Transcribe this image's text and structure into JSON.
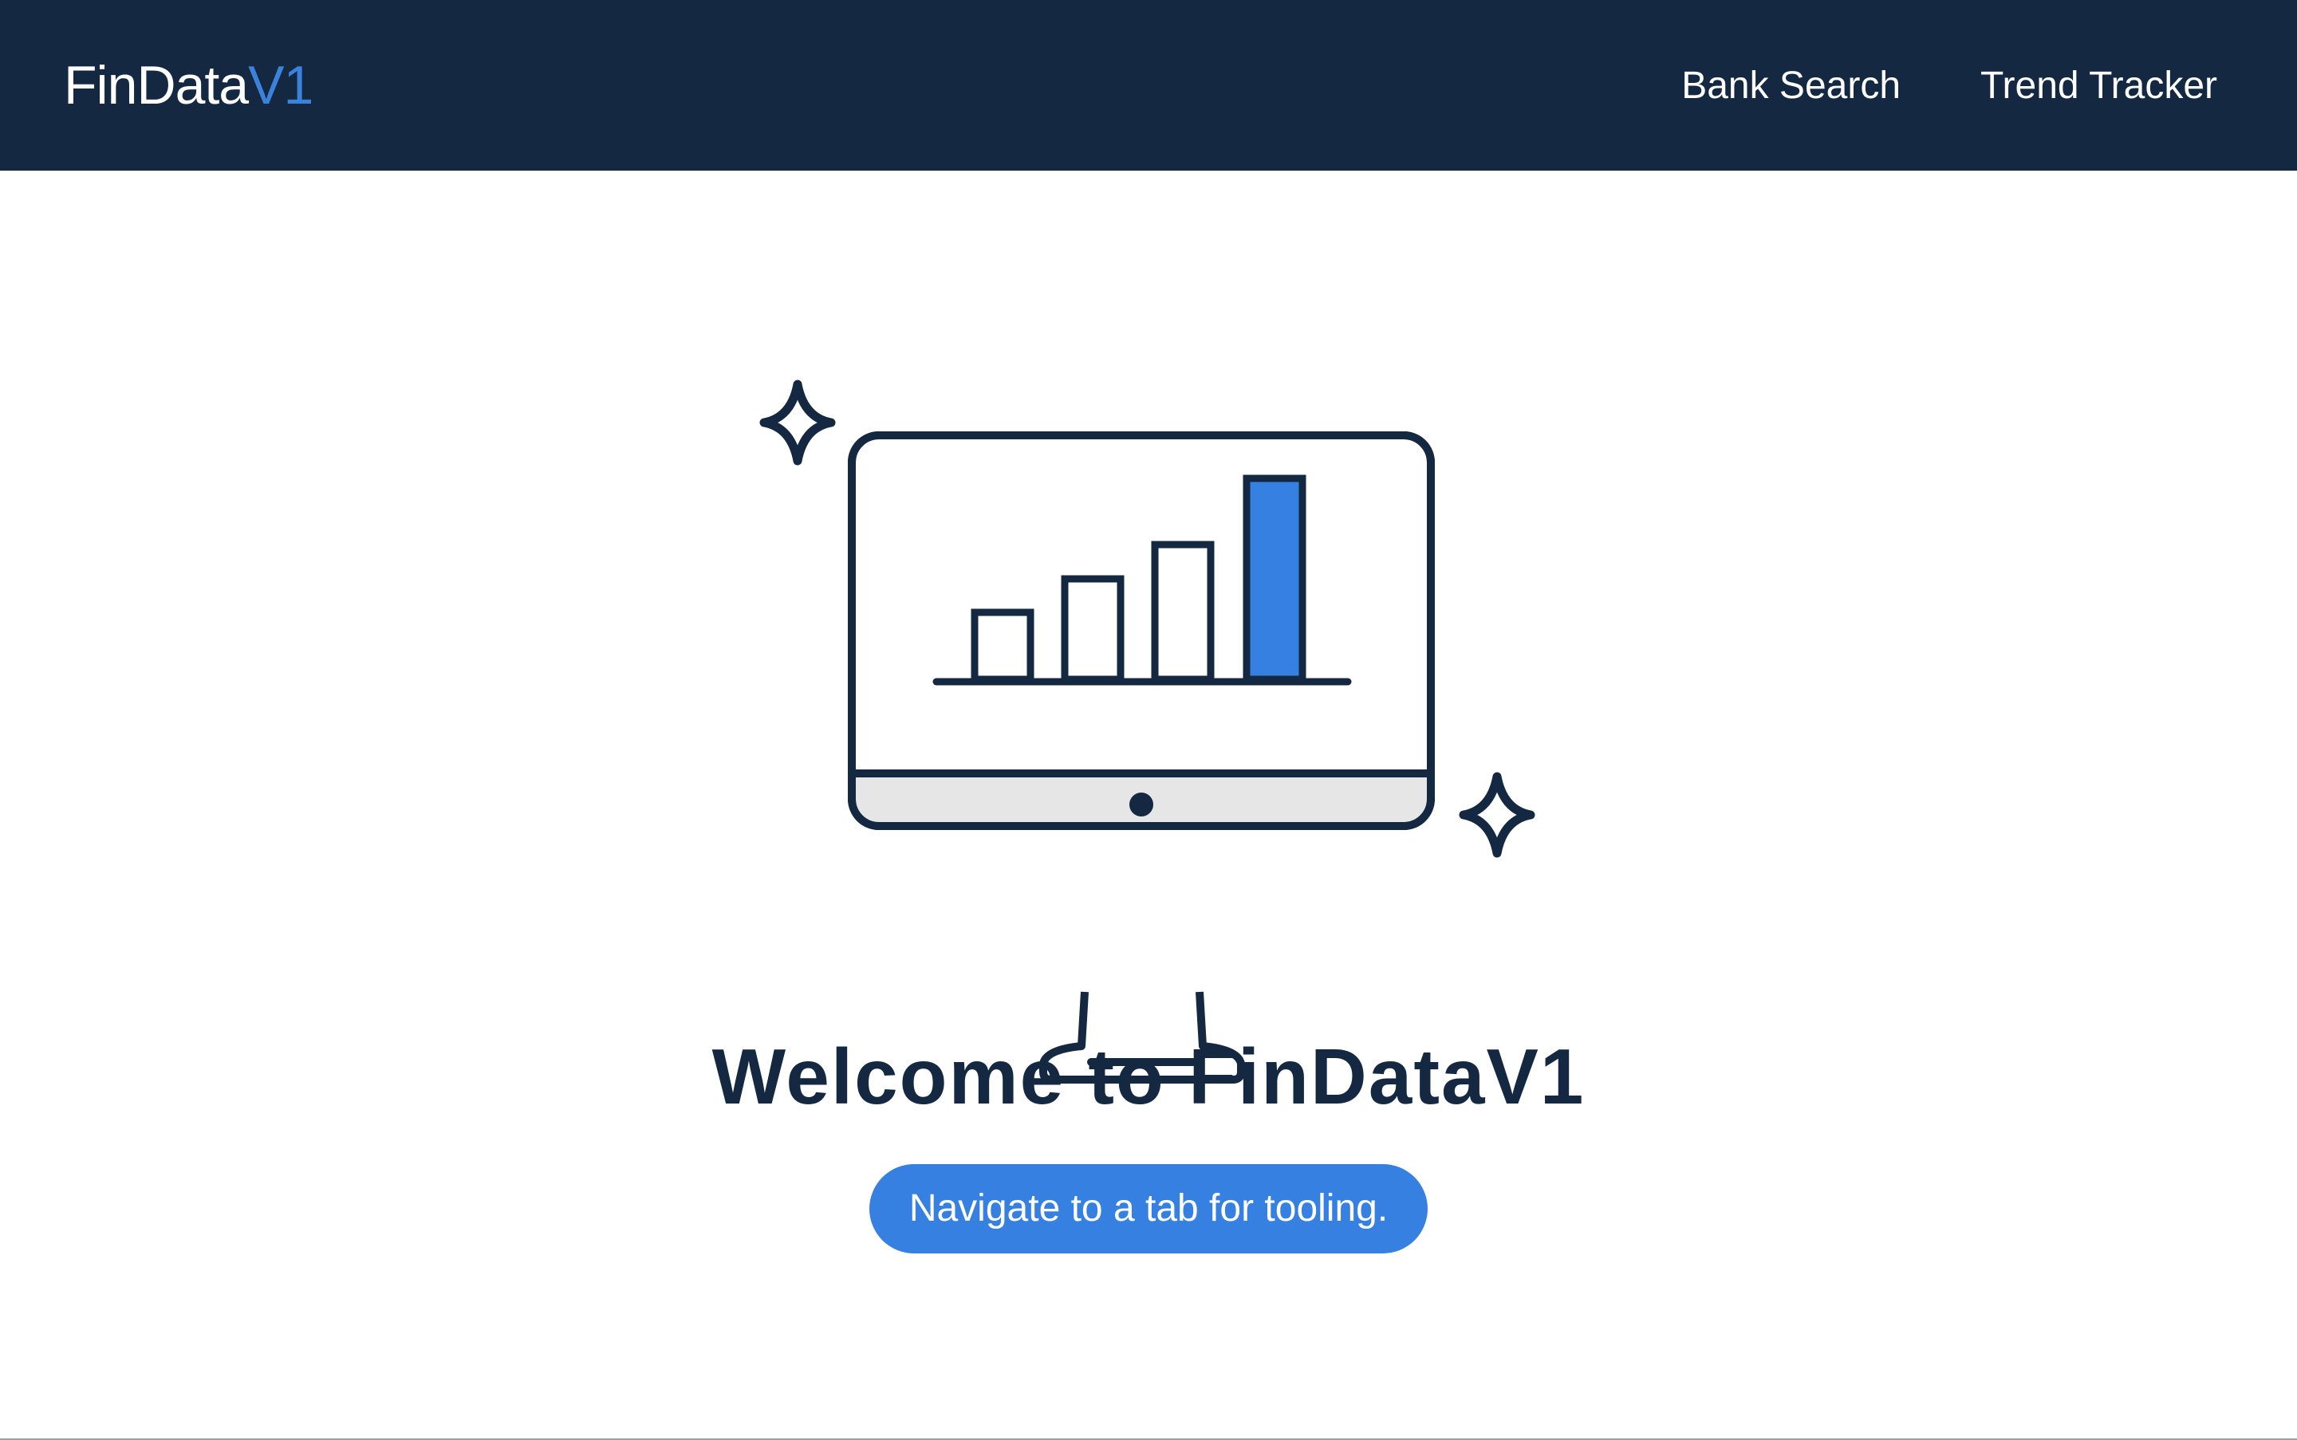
{
  "header": {
    "brand_main": "FinData",
    "brand_accent": "V1",
    "nav": [
      {
        "label": "Bank Search"
      },
      {
        "label": "Trend Tracker"
      }
    ]
  },
  "main": {
    "illustration_icon": "computer-with-bar-chart-icon",
    "welcome_title": "Welcome to FinDataV1",
    "cta_label": "Navigate to a tab for tooling."
  },
  "colors": {
    "navbar_bg": "#142842",
    "accent": "#3680e2",
    "text_dark": "#142842"
  }
}
